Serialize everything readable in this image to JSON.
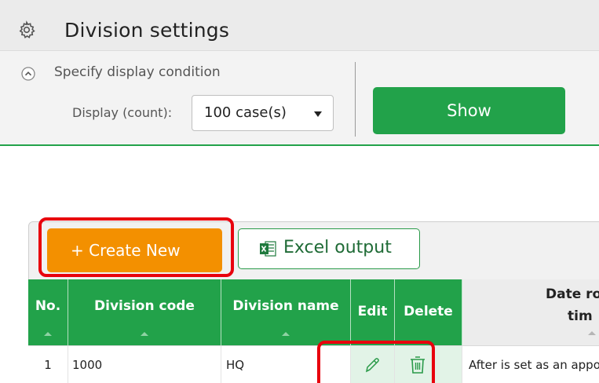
{
  "window": {
    "title": "Division settings",
    "title_icon": "gear-icon"
  },
  "condition_panel": {
    "toggle_label": "Specify display condition",
    "display_count_label": "Display (count):",
    "display_count_value": "100 case(s)",
    "show_button": "Show"
  },
  "toolbar": {
    "create_button": "+ Create New",
    "excel_button": "Excel output"
  },
  "table": {
    "headers": {
      "no": "No.",
      "division_code": "Division code",
      "division_name": "Division name",
      "edit": "Edit",
      "delete": "Delete",
      "date_line1": "Date ro",
      "date_line2": "tim"
    },
    "rows": [
      {
        "no": "1",
        "division_code": "1000",
        "division_name": "HQ",
        "date_text": "After is set as an appoi"
      }
    ]
  },
  "colors": {
    "primary_green": "#22a24a",
    "create_orange": "#f39000",
    "highlight_red": "#e8000d"
  }
}
